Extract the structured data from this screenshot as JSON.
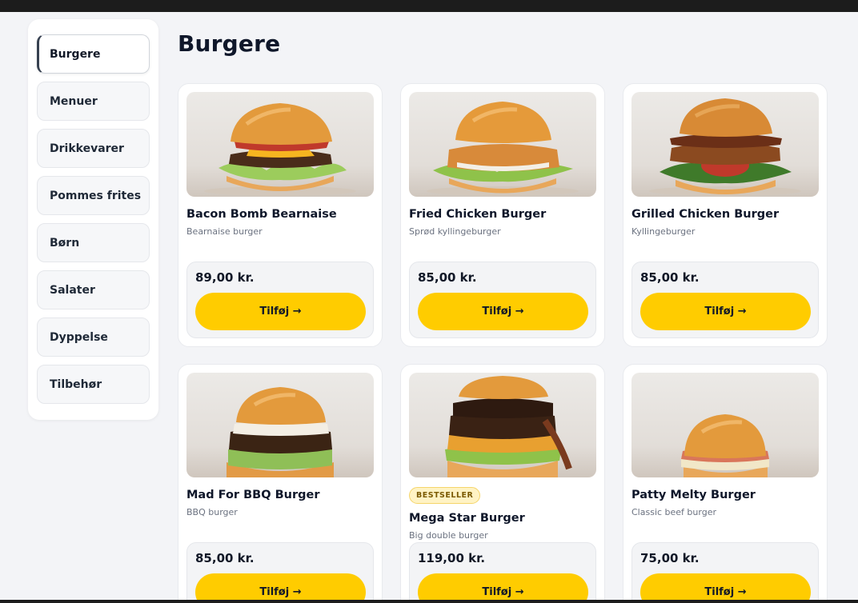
{
  "sidebar": {
    "items": [
      {
        "label": "Burgere"
      },
      {
        "label": "Menuer"
      },
      {
        "label": "Drikkevarer"
      },
      {
        "label": "Pommes frites"
      },
      {
        "label": "Børn"
      },
      {
        "label": "Salater"
      },
      {
        "label": "Dyppelse"
      },
      {
        "label": "Tilbehør"
      }
    ],
    "active_index": 0
  },
  "main": {
    "title": "Burgere",
    "add_label": "Tilføj →",
    "products": [
      {
        "name": "Bacon Bomb Bearnaise",
        "description": "Bearnaise burger",
        "price": "89,00 kr.",
        "badge": ""
      },
      {
        "name": "Fried Chicken Burger",
        "description": "Sprød kyllingeburger",
        "price": "85,00 kr.",
        "badge": ""
      },
      {
        "name": "Grilled Chicken Burger",
        "description": "Kyllingeburger",
        "price": "85,00 kr.",
        "badge": ""
      },
      {
        "name": "Mad For BBQ Burger",
        "description": "BBQ burger",
        "price": "85,00 kr.",
        "badge": ""
      },
      {
        "name": "Mega Star Burger",
        "description": "Big double burger",
        "price": "119,00 kr.",
        "badge": "BESTSELLER"
      },
      {
        "name": "Patty Melty Burger",
        "description": "Classic beef burger",
        "price": "75,00 kr.",
        "badge": ""
      }
    ]
  },
  "colors": {
    "accent": "#ffcc00",
    "background": "#f3f4f7",
    "badge_bg": "#fff3c4"
  }
}
